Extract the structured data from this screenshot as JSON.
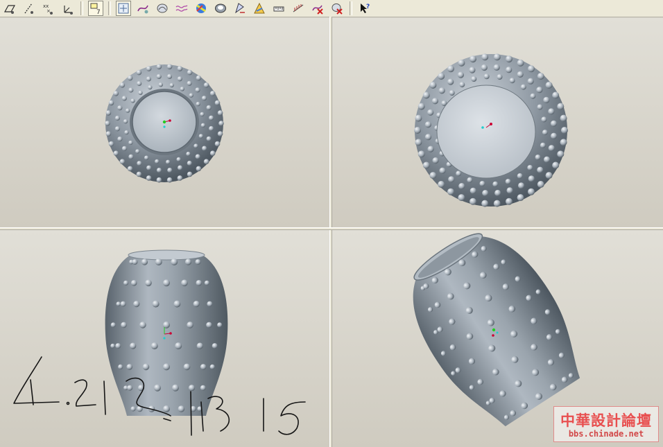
{
  "toolbar": {
    "tools": [
      {
        "name": "datum-plane-display-icon"
      },
      {
        "name": "datum-axis-display-icon"
      },
      {
        "name": "datum-point-display-icon"
      },
      {
        "name": "coordinate-system-display-icon"
      },
      {
        "name": "annotation-display-icon",
        "pressed": true
      },
      {
        "name": "spin-center-icon",
        "pressed": true
      },
      {
        "name": "style-surface-icon"
      },
      {
        "name": "boundary-blend-icon"
      },
      {
        "name": "sketch-curve-icon"
      },
      {
        "name": "curvature-analysis-icon"
      },
      {
        "name": "shading-analysis-icon"
      },
      {
        "name": "draft-analysis-icon"
      },
      {
        "name": "reflection-analysis-icon"
      },
      {
        "name": "measure-icon"
      },
      {
        "name": "section-analysis-icon"
      },
      {
        "name": "delete-curve-icon"
      },
      {
        "name": "delete-analysis-icon"
      },
      {
        "name": "context-help-icon"
      }
    ]
  },
  "viewports": [
    {
      "name": "viewport-top-view",
      "view": "top"
    },
    {
      "name": "viewport-bottom-view",
      "view": "bottom"
    },
    {
      "name": "viewport-front-view",
      "view": "front"
    },
    {
      "name": "viewport-isometric-view",
      "view": "isometric"
    }
  ],
  "annotation": {
    "handwritten_text": "4.21 2.13 15"
  },
  "watermark": {
    "title": "中華設計論壇",
    "url": "bbs.chinade.net"
  },
  "colors": {
    "model_fill": "#8b959f",
    "model_highlight": "#c5ccd3",
    "model_shadow": "#4e5861",
    "viewport_background": "#d8d5cc",
    "toolbar_background": "#ece9d8",
    "watermark_red": "#e85050"
  }
}
